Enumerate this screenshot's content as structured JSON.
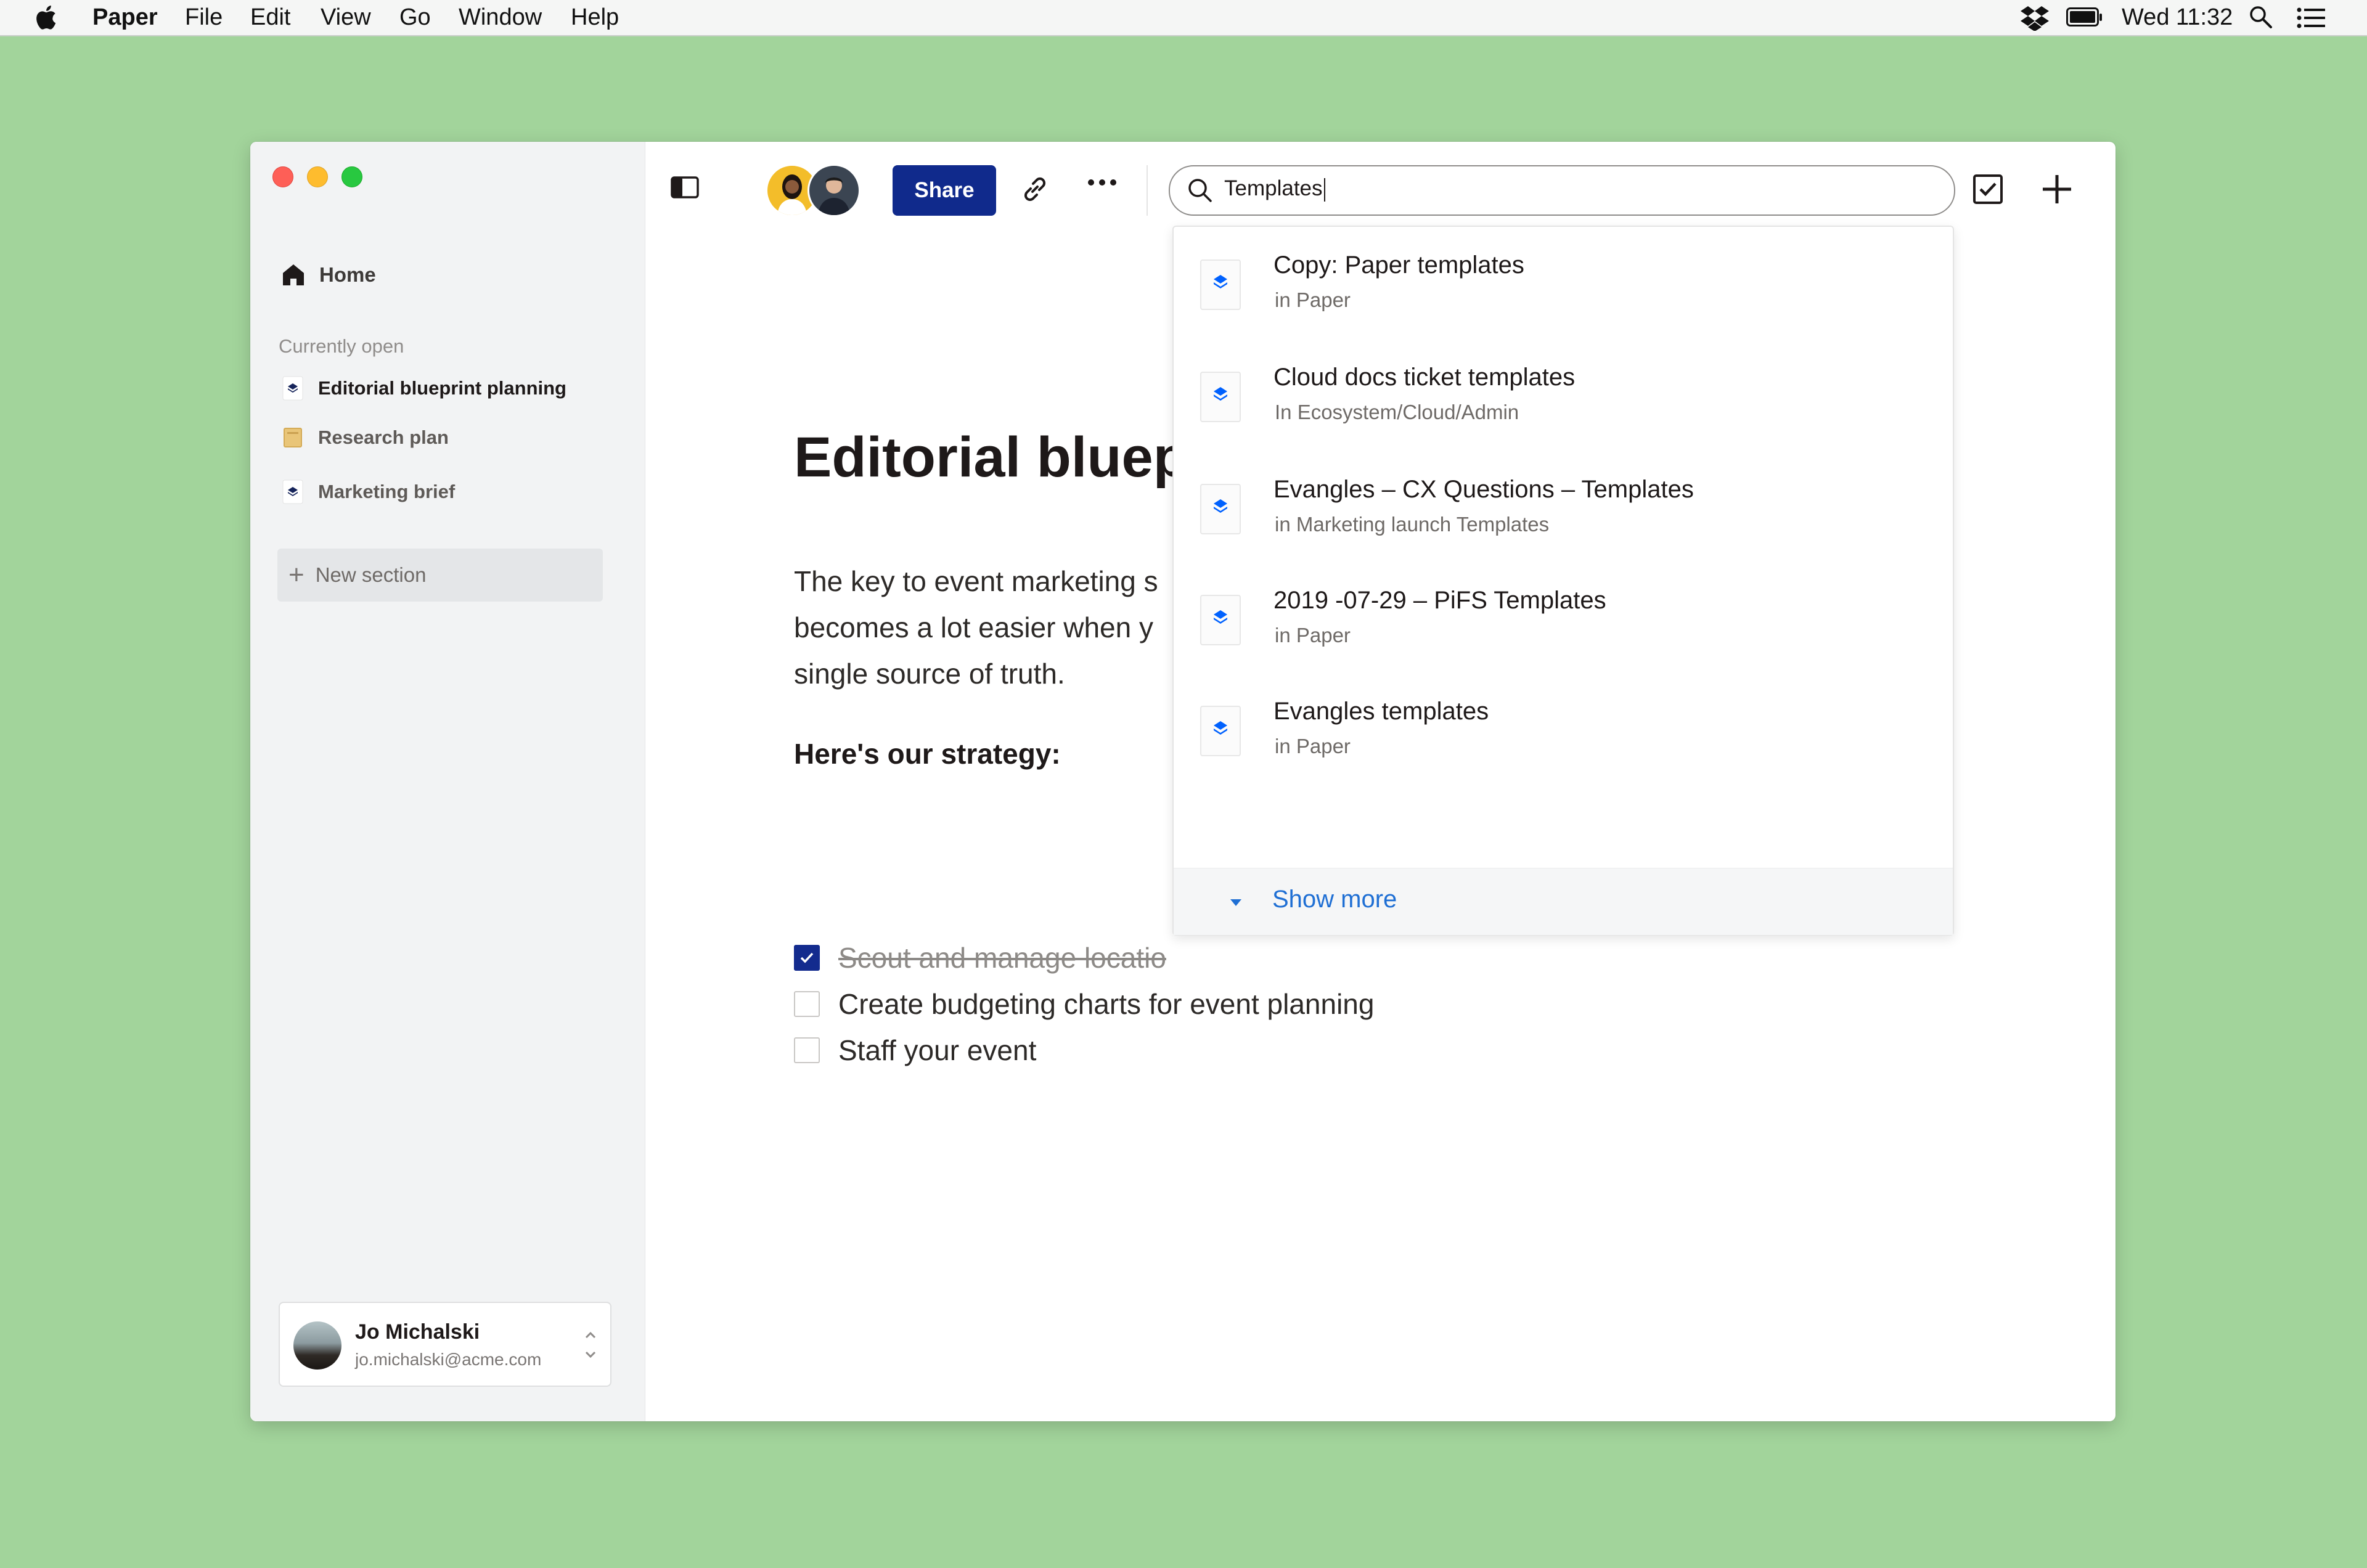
{
  "menubar": {
    "app_name": "Paper",
    "items": [
      "File",
      "Edit",
      "View",
      "Go",
      "Window",
      "Help"
    ],
    "clock": "Wed 11:32",
    "status_icons": [
      "dropbox-icon",
      "battery-icon",
      "spotlight-search-icon",
      "notification-center-icon"
    ]
  },
  "sidebar": {
    "home_label": "Home",
    "currently_open_header": "Currently open",
    "open_docs": [
      {
        "label": "Editorial blueprint planning",
        "icon": "paper-doc-icon",
        "active": true
      },
      {
        "label": "Research plan",
        "icon": "folder-doc-icon",
        "active": false
      },
      {
        "label": "Marketing brief",
        "icon": "paper-doc-icon",
        "active": false
      }
    ],
    "new_section_label": "New section"
  },
  "account": {
    "name": "Jo Michalski",
    "email": "jo.michalski@acme.com"
  },
  "toolbar": {
    "share_label": "Share",
    "search_value": "Templates"
  },
  "search_results": [
    {
      "title": "Copy: Paper templates",
      "location": "in Paper"
    },
    {
      "title": "Cloud docs ticket templates",
      "location": "In Ecosystem/Cloud/Admin"
    },
    {
      "title": "Evangles – CX Questions – Templates",
      "location": "in Marketing launch Templates"
    },
    {
      "title": "2019 -07-29 – PiFS Templates",
      "location": "in Paper"
    },
    {
      "title": "Evangles templates",
      "location": "in Paper"
    }
  ],
  "show_more_label": "Show more",
  "document": {
    "title": "Editorial bluep",
    "body_lines": [
      "The key to event marketing s",
      "becomes a lot easier when y",
      "single source of truth."
    ],
    "subheading": "Here's our strategy:",
    "todos": [
      {
        "text": "Scout and manage locatio",
        "done": true
      },
      {
        "text": "Create budgeting charts for event planning",
        "done": false
      },
      {
        "text": "Staff your event",
        "done": false
      }
    ]
  },
  "colors": {
    "desktop": "#a2d49b",
    "share_button": "#102a8c",
    "link_blue": "#1f6fd4",
    "dropbox_blue": "#0061fe"
  }
}
